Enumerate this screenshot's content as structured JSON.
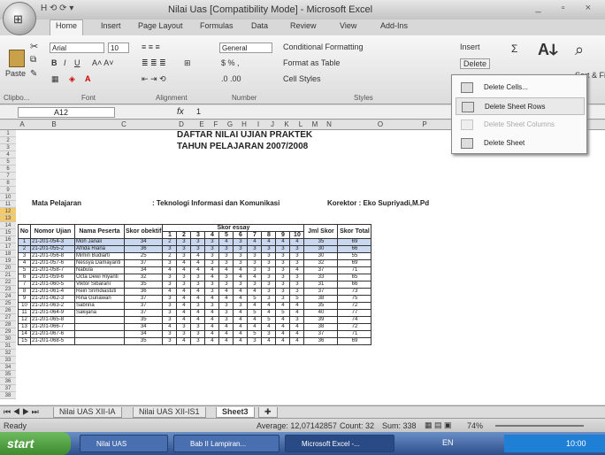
{
  "window": {
    "title": "Nilai Uas  [Compatibility Mode] - Microsoft Excel",
    "controls": "_ ▫ ×"
  },
  "qat": "H ⟲ ⟳ ▾",
  "tabs": [
    "Home",
    "Insert",
    "Page Layout",
    "Formulas",
    "Data",
    "Review",
    "View",
    "Add-Ins"
  ],
  "ribbon": {
    "paste": "Paste",
    "font_name": "Arial",
    "font_size": "10",
    "number_format": "General",
    "conditional": "Conditional Formatting",
    "format_table": "Format as Table",
    "cell_styles": "Cell Styles",
    "insert": "Insert",
    "delete": "Delete",
    "sigma": "Σ",
    "sort": "Sort & Find &",
    "groups": {
      "clipboard": "Clipbo...",
      "font": "Font",
      "alignment": "Alignment",
      "number": "Number",
      "styles": "Styles"
    }
  },
  "delete_menu": [
    {
      "label": "Delete Cells...",
      "state": "normal"
    },
    {
      "label": "Delete Sheet Rows",
      "state": "highlight"
    },
    {
      "label": "Delete Sheet Columns",
      "state": "disabled"
    },
    {
      "label": "Delete Sheet",
      "state": "normal"
    }
  ],
  "formula_bar": {
    "name_box": "A12",
    "fx": "fx",
    "value": "1"
  },
  "columns": [
    "A",
    "B",
    "C",
    "D",
    "E",
    "F",
    "G",
    "H",
    "I",
    "J",
    "K",
    "L",
    "M",
    "N",
    "O",
    "P"
  ],
  "sheet": {
    "title1": "DAFTAR NILAI UJIAN PRAKTEK",
    "title2": "TAHUN PELAJARAN 2007/2008",
    "mata_pelajaran_label": "Mata Pelajaran",
    "mata_pelajaran_value": ": Teknologi Informasi dan Komunikasi",
    "korektor": "Korektor : Eko Supriyadi,M.Pd",
    "headers": {
      "no": "No",
      "nomor": "Nomor Ujian",
      "nama": "Nama Peserta",
      "skor_obj": "Skor obektif",
      "essay": "Skor essay",
      "jml": "Jml Skor",
      "total": "Skor Total"
    },
    "essay_cols": [
      "1",
      "2",
      "3",
      "4",
      "5",
      "6",
      "7",
      "8",
      "9",
      "10"
    ],
    "rows": [
      [
        "1",
        "21-201-054-3",
        "Moh Janali",
        "34",
        "2",
        "3",
        "3",
        "3",
        "4",
        "3",
        "4",
        "4",
        "4",
        "4",
        "35",
        "69"
      ],
      [
        "2",
        "21-201-055-2",
        "Afrida Riana",
        "36",
        "3",
        "3",
        "3",
        "3",
        "3",
        "3",
        "3",
        "3",
        "3",
        "3",
        "30",
        "66"
      ],
      [
        "3",
        "21-201-056-8",
        "Mimin Budiarti",
        "25",
        "2",
        "3",
        "4",
        "3",
        "3",
        "3",
        "3",
        "3",
        "3",
        "3",
        "30",
        "55"
      ],
      [
        "4",
        "21-201-057-6",
        "Nessya Damayanti",
        "37",
        "3",
        "4",
        "4",
        "3",
        "3",
        "3",
        "3",
        "3",
        "3",
        "3",
        "32",
        "69"
      ],
      [
        "5",
        "21-201-058-7",
        "Nabula",
        "34",
        "4",
        "4",
        "4",
        "4",
        "4",
        "4",
        "3",
        "3",
        "3",
        "4",
        "37",
        "71"
      ],
      [
        "6",
        "21-201-059-6",
        "Octa Dewi Riyanti",
        "32",
        "3",
        "3",
        "3",
        "4",
        "3",
        "4",
        "4",
        "3",
        "3",
        "3",
        "33",
        "65"
      ],
      [
        "7",
        "21-201-060-5",
        "Viktor Sibarani",
        "35",
        "3",
        "3",
        "3",
        "3",
        "3",
        "3",
        "3",
        "3",
        "3",
        "3",
        "31",
        "66"
      ],
      [
        "8",
        "21-201-061-4",
        "Rein Srimdiastuti",
        "36",
        "4",
        "4",
        "4",
        "3",
        "4",
        "4",
        "4",
        "3",
        "3",
        "3",
        "37",
        "73"
      ],
      [
        "9",
        "21-201-062-3",
        "Rina Gunawan",
        "37",
        "3",
        "4",
        "4",
        "4",
        "4",
        "4",
        "5",
        "3",
        "3",
        "5",
        "38",
        "75"
      ],
      [
        "10",
        "21-201-063-2",
        "Sabrina",
        "37",
        "3",
        "4",
        "3",
        "3",
        "3",
        "3",
        "4",
        "4",
        "4",
        "4",
        "35",
        "72"
      ],
      [
        "11",
        "21-201-064-9",
        "Sakijana",
        "37",
        "3",
        "4",
        "4",
        "4",
        "3",
        "4",
        "5",
        "4",
        "5",
        "4",
        "40",
        "77"
      ],
      [
        "12",
        "21-201-065-8",
        "",
        "35",
        "3",
        "4",
        "4",
        "4",
        "3",
        "4",
        "4",
        "5",
        "4",
        "3",
        "39",
        "74"
      ],
      [
        "13",
        "21-201-066-7",
        "",
        "34",
        "4",
        "3",
        "3",
        "4",
        "4",
        "4",
        "4",
        "4",
        "4",
        "4",
        "38",
        "72"
      ],
      [
        "14",
        "21-201-067-6",
        "",
        "34",
        "3",
        "3",
        "3",
        "4",
        "4",
        "4",
        "5",
        "3",
        "4",
        "4",
        "37",
        "71"
      ],
      [
        "15",
        "21-201-068-5",
        "",
        "35",
        "3",
        "4",
        "3",
        "4",
        "4",
        "4",
        "3",
        "4",
        "4",
        "4",
        "36",
        "69"
      ]
    ]
  },
  "sheet_tabs": [
    "Nilai UAS XII-IA",
    "Nilai UAS XII-IS1",
    "Sheet3"
  ],
  "status": {
    "ready": "Ready",
    "average": "Average: 12,07142857",
    "count": "Count: 32",
    "sum": "Sum: 338",
    "zoom": "74%"
  },
  "taskbar": {
    "start": "start",
    "items": [
      "Nilai UAS",
      "Bab II Lampiran...",
      "Microsoft Excel -...",
      "EN"
    ],
    "clock": "10:00"
  }
}
